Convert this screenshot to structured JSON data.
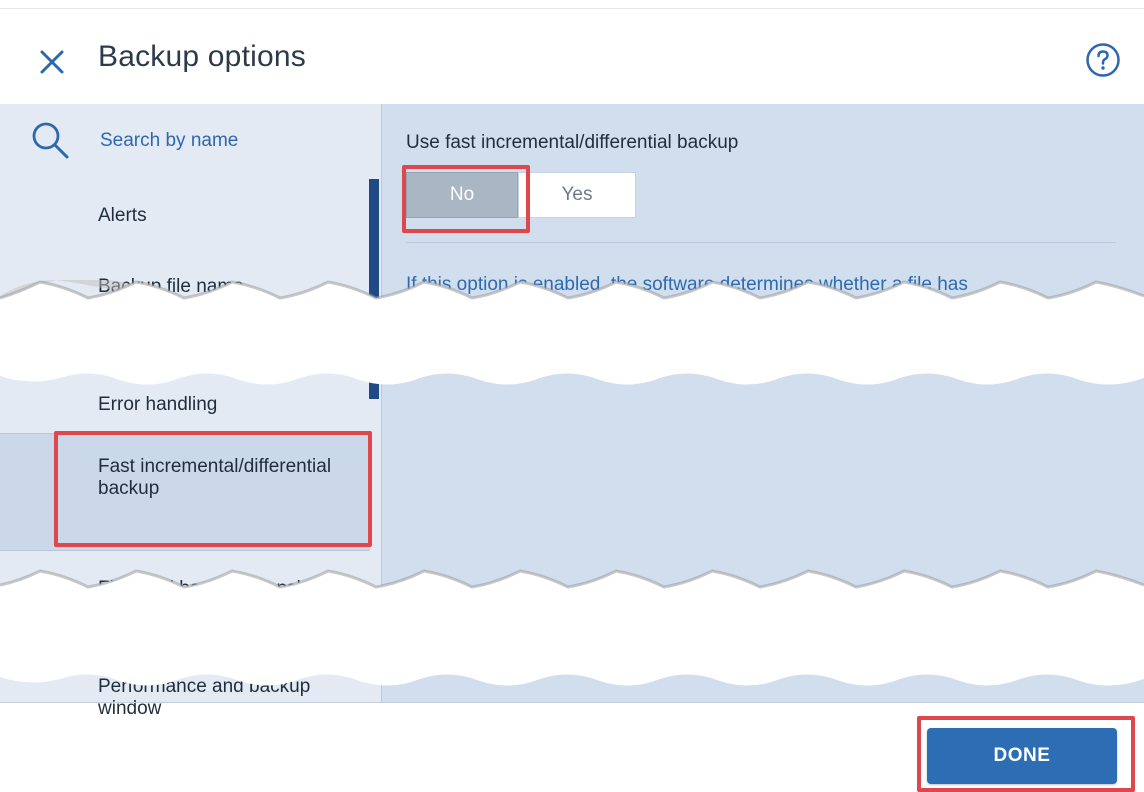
{
  "header": {
    "title": "Backup options",
    "close_icon": "close-icon",
    "help_icon": "help-icon"
  },
  "sidebar": {
    "search": {
      "placeholder": "Search by name",
      "value": ""
    },
    "items": [
      {
        "label": "Alerts"
      },
      {
        "label": "Backup file name"
      },
      {
        "label": "Error handling"
      },
      {
        "label": "Fast incremental/differential backup",
        "active": true
      },
      {
        "label": "File-level backup snapshot"
      },
      {
        "label": "Performance and backup window"
      }
    ]
  },
  "content": {
    "option_title": "Use fast incremental/differential backup",
    "toggle": {
      "no_label": "No",
      "yes_label": "Yes",
      "selected": "No"
    },
    "description": "If this option is enabled, the software determines whether a file has"
  },
  "footer": {
    "done_label": "DONE"
  },
  "colors": {
    "accent": "#2d6db4",
    "highlight": "#e0474c",
    "panel_bg": "#d0deee",
    "sidebar_bg": "#e3eaf4"
  }
}
